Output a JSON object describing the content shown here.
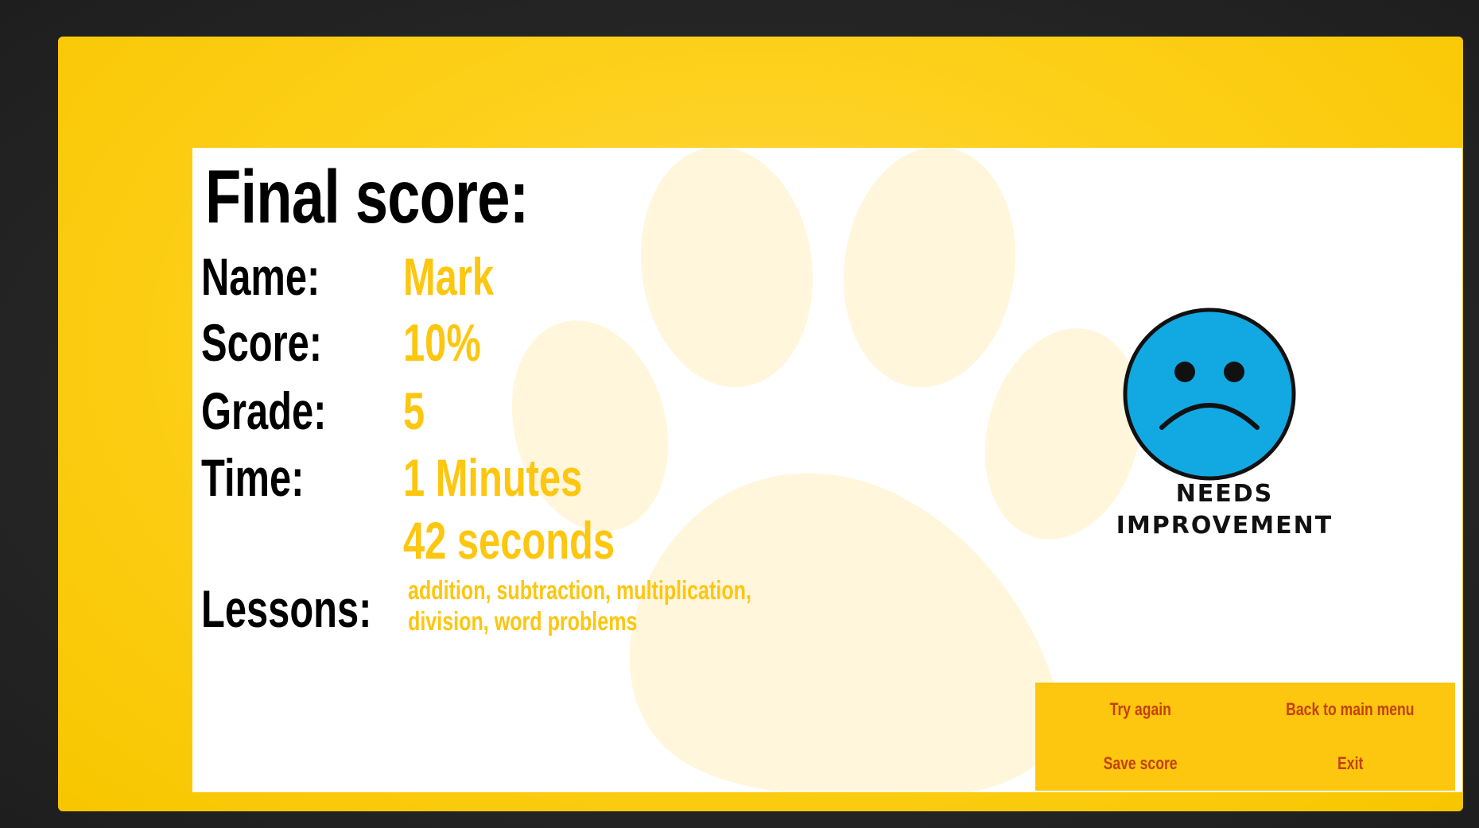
{
  "title": "Final score:",
  "fields": {
    "name_label": "Name:",
    "name_value": "Mark",
    "score_label": "Score:",
    "score_value": "10%",
    "grade_label": "Grade:",
    "grade_value": "5",
    "time_label": "Time:",
    "time_value_line1": "1 Minutes",
    "time_value_line2": "42 seconds",
    "lessons_label": "Lessons:",
    "lessons_value": "addition, subtraction, multiplication, division, word problems"
  },
  "result": {
    "icon": "sad-face-icon",
    "label_line1": "NEEDS",
    "label_line2": "IMPROVEMENT",
    "face_color": "#12a9e3"
  },
  "menu": {
    "try_again": "Try again",
    "main_menu": "Back to main menu",
    "save_score": "Save score",
    "exit": "Exit"
  },
  "colors": {
    "frame": "#fdd11d",
    "accent_text": "#fdc60f",
    "button_text": "#c2410c"
  }
}
